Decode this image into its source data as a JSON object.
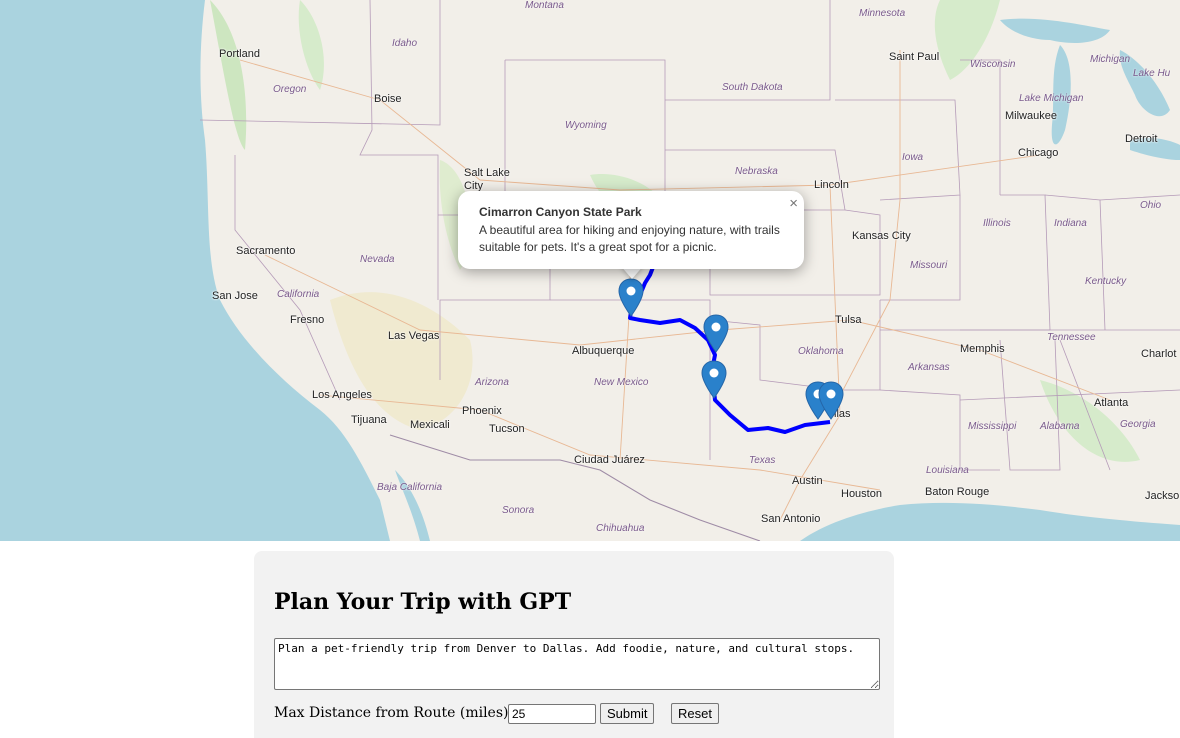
{
  "map": {
    "cities": [
      {
        "name": "Portland",
        "cls": "city"
      },
      {
        "name": "Boise",
        "cls": "city"
      },
      {
        "name": "Salt Lake City",
        "cls": "city"
      },
      {
        "name": "Sacramento",
        "cls": "city"
      },
      {
        "name": "San Jose",
        "cls": "city"
      },
      {
        "name": "Fresno",
        "cls": "city"
      },
      {
        "name": "Las Vegas",
        "cls": "city"
      },
      {
        "name": "Los Angeles",
        "cls": "city"
      },
      {
        "name": "Tijuana",
        "cls": "city"
      },
      {
        "name": "Mexicali",
        "cls": "city"
      },
      {
        "name": "Phoenix",
        "cls": "city"
      },
      {
        "name": "Tucson",
        "cls": "city"
      },
      {
        "name": "Albuquerque",
        "cls": "city"
      },
      {
        "name": "Ciudad Juárez",
        "cls": "city"
      },
      {
        "name": "Saint Paul",
        "cls": "city"
      },
      {
        "name": "Milwaukee",
        "cls": "city"
      },
      {
        "name": "Detroit",
        "cls": "city"
      },
      {
        "name": "Chicago",
        "cls": "city"
      },
      {
        "name": "Lincoln",
        "cls": "city"
      },
      {
        "name": "Kansas City",
        "cls": "city"
      },
      {
        "name": "Tulsa",
        "cls": "city"
      },
      {
        "name": "Memphis",
        "cls": "city"
      },
      {
        "name": "Charlot",
        "cls": "city"
      },
      {
        "name": "Atlanta",
        "cls": "city"
      },
      {
        "name": "Austin",
        "cls": "city"
      },
      {
        "name": "Houston",
        "cls": "city"
      },
      {
        "name": "Baton Rouge",
        "cls": "city"
      },
      {
        "name": "San Antonio",
        "cls": "city"
      },
      {
        "name": "Jackso",
        "cls": "city"
      },
      {
        "name": "llas",
        "cls": "city"
      }
    ],
    "states": [
      "Montana",
      "Minnesota",
      "Idaho",
      "Wisconsin",
      "Michigan",
      "Lake Hu",
      "Oregon",
      "South Dakota",
      "Lake Michigan",
      "Wyoming",
      "Iowa",
      "Nebraska",
      "Ohio",
      "Illinois",
      "Indiana",
      "Nevada",
      "Missouri",
      "California",
      "Kentucky",
      "Oklahoma",
      "Tennessee",
      "Arizona",
      "New Mexico",
      "Arkansas",
      "Mississippi",
      "Alabama",
      "Georgia",
      "Texas",
      "Louisiana",
      "Baja California",
      "Sonora",
      "Chihuahua"
    ]
  },
  "popup": {
    "title": "Cimarron Canyon State Park",
    "description": "A beautiful area for hiking and enjoying nature, with trails suitable for pets. It's a great spot for a picnic.",
    "close": "×"
  },
  "form": {
    "heading": "Plan Your Trip with GPT",
    "prompt_value": "Plan a pet-friendly trip from Denver to Dallas. Add foodie, nature, and cultural stops.",
    "distance_label": "Max Distance from Route (miles):",
    "distance_value": "25",
    "submit_label": "Submit",
    "reset_label": "Reset"
  },
  "colors": {
    "route": "#0000ff",
    "marker": "#2a81cb",
    "water": "#aad3df"
  }
}
